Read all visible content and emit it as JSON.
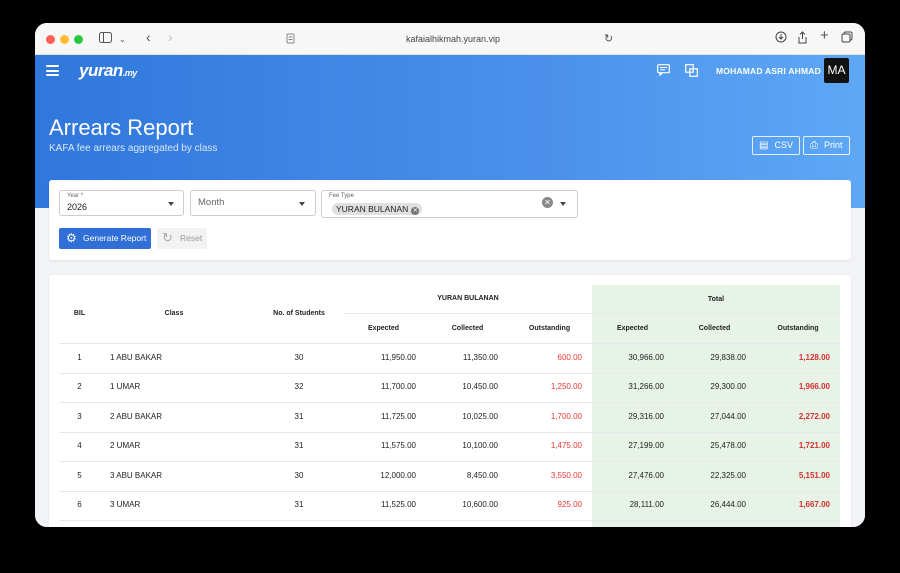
{
  "browser": {
    "url": "kafaialhikmah.yuran.vip"
  },
  "app": {
    "logo": "yuran",
    "logo_suffix": ".my",
    "user_name": "MOHAMAD ASRI AHMAD",
    "avatar_initials": "MA"
  },
  "page": {
    "title": "Arrears Report",
    "subtitle": "KAFA fee arrears aggregated by class",
    "csv_label": "CSV",
    "print_label": "Print"
  },
  "filters": {
    "year_label": "Year *",
    "year_value": "2026",
    "month_placeholder": "Month",
    "fee_type_label": "Fee Type",
    "fee_type_chip": "YURAN BULANAN",
    "generate_label": "Generate Report",
    "reset_label": "Reset"
  },
  "table": {
    "headers": {
      "bil": "BIL",
      "class": "Class",
      "students": "No. of Students",
      "group_fee": "YURAN BULANAN",
      "group_total": "Total",
      "expected": "Expected",
      "collected": "Collected",
      "outstanding": "Outstanding"
    },
    "rows": [
      {
        "bil": "1",
        "class": "1 ABU BAKAR",
        "students": "30",
        "expected": "11,950.00",
        "collected": "11,350.00",
        "outstanding": "600.00",
        "total_expected": "30,966.00",
        "total_collected": "29,838.00",
        "total_outstanding": "1,128.00"
      },
      {
        "bil": "2",
        "class": "1 UMAR",
        "students": "32",
        "expected": "11,700.00",
        "collected": "10,450.00",
        "outstanding": "1,250.00",
        "total_expected": "31,266.00",
        "total_collected": "29,300.00",
        "total_outstanding": "1,966.00"
      },
      {
        "bil": "3",
        "class": "2 ABU BAKAR",
        "students": "31",
        "expected": "11,725.00",
        "collected": "10,025.00",
        "outstanding": "1,700.00",
        "total_expected": "29,316.00",
        "total_collected": "27,044.00",
        "total_outstanding": "2,272.00"
      },
      {
        "bil": "4",
        "class": "2 UMAR",
        "students": "31",
        "expected": "11,575.00",
        "collected": "10,100.00",
        "outstanding": "1,475.00",
        "total_expected": "27,199.00",
        "total_collected": "25,478.00",
        "total_outstanding": "1,721.00"
      },
      {
        "bil": "5",
        "class": "3 ABU BAKAR",
        "students": "30",
        "expected": "12,000.00",
        "collected": "8,450.00",
        "outstanding": "3,550.00",
        "total_expected": "27,476.00",
        "total_collected": "22,325.00",
        "total_outstanding": "5,151.00"
      },
      {
        "bil": "6",
        "class": "3 UMAR",
        "students": "31",
        "expected": "11,525.00",
        "collected": "10,600.00",
        "outstanding": "925.00",
        "total_expected": "28,111.00",
        "total_collected": "26,444.00",
        "total_outstanding": "1,667.00"
      }
    ]
  }
}
